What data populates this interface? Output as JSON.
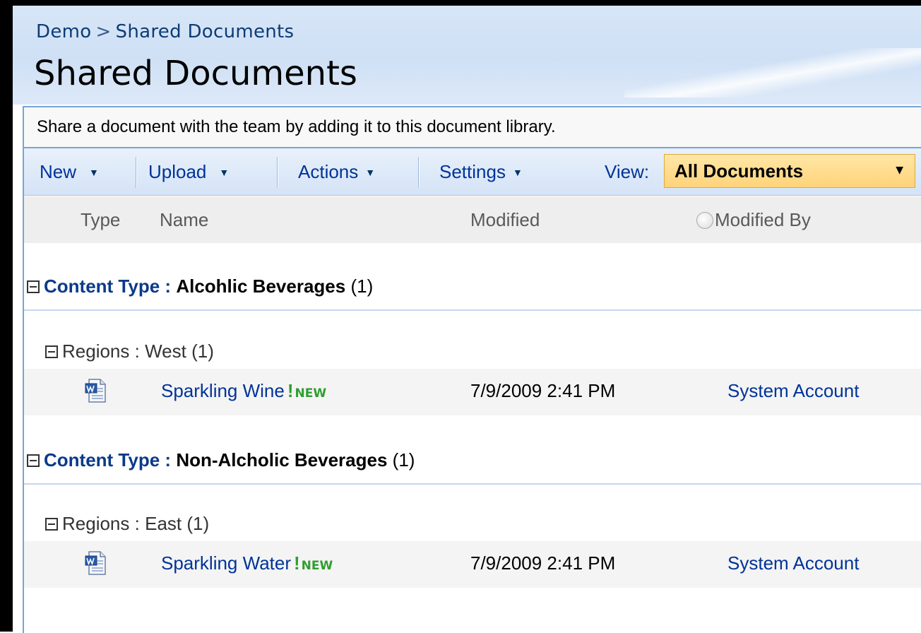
{
  "breadcrumb": {
    "site": "Demo",
    "separator": ">",
    "current": "Shared Documents"
  },
  "page_title": "Shared Documents",
  "description": "Share a document with the team by adding it to this document library.",
  "toolbar": {
    "new_label": "New",
    "upload_label": "Upload",
    "actions_label": "Actions",
    "settings_label": "Settings",
    "view_label": "View:",
    "view_selected": "All Documents",
    "arrow": "▼"
  },
  "columns": {
    "type": "Type",
    "name": "Name",
    "modified": "Modified",
    "modified_by": "Modified By"
  },
  "groups": [
    {
      "label": "Content Type",
      "separator": ":",
      "value": "Alcohlic Beverages",
      "count": "(1)",
      "subgroup": {
        "label": "Regions",
        "separator": ":",
        "value": "West",
        "count": "(1)",
        "items": [
          {
            "name": "Sparkling Wine",
            "new_mark": "!",
            "new_text": "NEW",
            "modified": "7/9/2009 2:41 PM",
            "modified_by": "System Account",
            "icon": "word-document-icon"
          }
        ]
      }
    },
    {
      "label": "Content Type",
      "separator": ":",
      "value": "Non-Alcholic Beverages",
      "count": "(1)",
      "subgroup": {
        "label": "Regions",
        "separator": ":",
        "value": "East",
        "count": "(1)",
        "items": [
          {
            "name": "Sparkling Water",
            "new_mark": "!",
            "new_text": "NEW",
            "modified": "7/9/2009 2:41 PM",
            "modified_by": "System Account",
            "icon": "word-document-icon"
          }
        ]
      }
    }
  ],
  "colors": {
    "link": "#003399",
    "group_label": "#0b3a89",
    "new_badge": "#2f9e2f",
    "view_highlight": "#ffd37a",
    "border": "#7aa3d6"
  }
}
